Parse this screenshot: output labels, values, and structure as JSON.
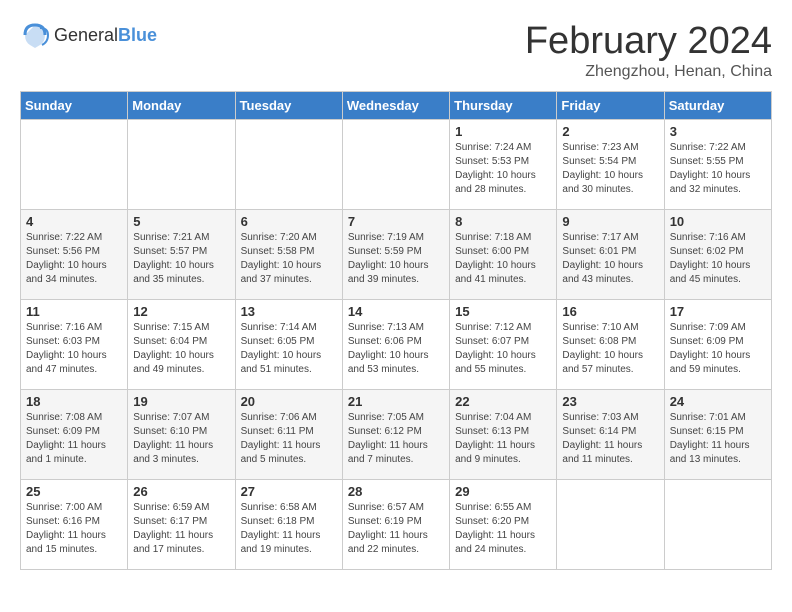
{
  "logo": {
    "general": "General",
    "blue": "Blue"
  },
  "title": "February 2024",
  "location": "Zhengzhou, Henan, China",
  "days_of_week": [
    "Sunday",
    "Monday",
    "Tuesday",
    "Wednesday",
    "Thursday",
    "Friday",
    "Saturday"
  ],
  "weeks": [
    [
      {
        "day": "",
        "content": ""
      },
      {
        "day": "",
        "content": ""
      },
      {
        "day": "",
        "content": ""
      },
      {
        "day": "",
        "content": ""
      },
      {
        "day": "1",
        "content": "Sunrise: 7:24 AM\nSunset: 5:53 PM\nDaylight: 10 hours\nand 28 minutes."
      },
      {
        "day": "2",
        "content": "Sunrise: 7:23 AM\nSunset: 5:54 PM\nDaylight: 10 hours\nand 30 minutes."
      },
      {
        "day": "3",
        "content": "Sunrise: 7:22 AM\nSunset: 5:55 PM\nDaylight: 10 hours\nand 32 minutes."
      }
    ],
    [
      {
        "day": "4",
        "content": "Sunrise: 7:22 AM\nSunset: 5:56 PM\nDaylight: 10 hours\nand 34 minutes."
      },
      {
        "day": "5",
        "content": "Sunrise: 7:21 AM\nSunset: 5:57 PM\nDaylight: 10 hours\nand 35 minutes."
      },
      {
        "day": "6",
        "content": "Sunrise: 7:20 AM\nSunset: 5:58 PM\nDaylight: 10 hours\nand 37 minutes."
      },
      {
        "day": "7",
        "content": "Sunrise: 7:19 AM\nSunset: 5:59 PM\nDaylight: 10 hours\nand 39 minutes."
      },
      {
        "day": "8",
        "content": "Sunrise: 7:18 AM\nSunset: 6:00 PM\nDaylight: 10 hours\nand 41 minutes."
      },
      {
        "day": "9",
        "content": "Sunrise: 7:17 AM\nSunset: 6:01 PM\nDaylight: 10 hours\nand 43 minutes."
      },
      {
        "day": "10",
        "content": "Sunrise: 7:16 AM\nSunset: 6:02 PM\nDaylight: 10 hours\nand 45 minutes."
      }
    ],
    [
      {
        "day": "11",
        "content": "Sunrise: 7:16 AM\nSunset: 6:03 PM\nDaylight: 10 hours\nand 47 minutes."
      },
      {
        "day": "12",
        "content": "Sunrise: 7:15 AM\nSunset: 6:04 PM\nDaylight: 10 hours\nand 49 minutes."
      },
      {
        "day": "13",
        "content": "Sunrise: 7:14 AM\nSunset: 6:05 PM\nDaylight: 10 hours\nand 51 minutes."
      },
      {
        "day": "14",
        "content": "Sunrise: 7:13 AM\nSunset: 6:06 PM\nDaylight: 10 hours\nand 53 minutes."
      },
      {
        "day": "15",
        "content": "Sunrise: 7:12 AM\nSunset: 6:07 PM\nDaylight: 10 hours\nand 55 minutes."
      },
      {
        "day": "16",
        "content": "Sunrise: 7:10 AM\nSunset: 6:08 PM\nDaylight: 10 hours\nand 57 minutes."
      },
      {
        "day": "17",
        "content": "Sunrise: 7:09 AM\nSunset: 6:09 PM\nDaylight: 10 hours\nand 59 minutes."
      }
    ],
    [
      {
        "day": "18",
        "content": "Sunrise: 7:08 AM\nSunset: 6:09 PM\nDaylight: 11 hours\nand 1 minute."
      },
      {
        "day": "19",
        "content": "Sunrise: 7:07 AM\nSunset: 6:10 PM\nDaylight: 11 hours\nand 3 minutes."
      },
      {
        "day": "20",
        "content": "Sunrise: 7:06 AM\nSunset: 6:11 PM\nDaylight: 11 hours\nand 5 minutes."
      },
      {
        "day": "21",
        "content": "Sunrise: 7:05 AM\nSunset: 6:12 PM\nDaylight: 11 hours\nand 7 minutes."
      },
      {
        "day": "22",
        "content": "Sunrise: 7:04 AM\nSunset: 6:13 PM\nDaylight: 11 hours\nand 9 minutes."
      },
      {
        "day": "23",
        "content": "Sunrise: 7:03 AM\nSunset: 6:14 PM\nDaylight: 11 hours\nand 11 minutes."
      },
      {
        "day": "24",
        "content": "Sunrise: 7:01 AM\nSunset: 6:15 PM\nDaylight: 11 hours\nand 13 minutes."
      }
    ],
    [
      {
        "day": "25",
        "content": "Sunrise: 7:00 AM\nSunset: 6:16 PM\nDaylight: 11 hours\nand 15 minutes."
      },
      {
        "day": "26",
        "content": "Sunrise: 6:59 AM\nSunset: 6:17 PM\nDaylight: 11 hours\nand 17 minutes."
      },
      {
        "day": "27",
        "content": "Sunrise: 6:58 AM\nSunset: 6:18 PM\nDaylight: 11 hours\nand 19 minutes."
      },
      {
        "day": "28",
        "content": "Sunrise: 6:57 AM\nSunset: 6:19 PM\nDaylight: 11 hours\nand 22 minutes."
      },
      {
        "day": "29",
        "content": "Sunrise: 6:55 AM\nSunset: 6:20 PM\nDaylight: 11 hours\nand 24 minutes."
      },
      {
        "day": "",
        "content": ""
      },
      {
        "day": "",
        "content": ""
      }
    ]
  ]
}
